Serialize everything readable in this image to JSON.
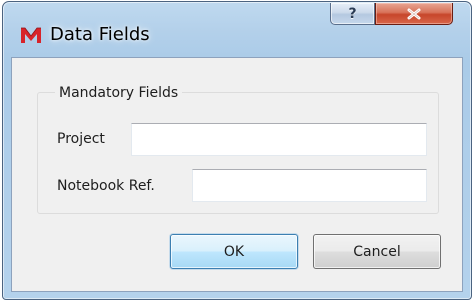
{
  "window": {
    "title": "Data Fields",
    "app_icon": "app-logo-m-icon",
    "controls": {
      "help_label": "?",
      "close_icon": "close-icon"
    }
  },
  "group": {
    "title": "Mandatory Fields",
    "fields": {
      "project": {
        "label": "Project",
        "value": ""
      },
      "notebook_ref": {
        "label": "Notebook Ref.",
        "value": ""
      }
    }
  },
  "buttons": {
    "ok_label": "OK",
    "cancel_label": "Cancel"
  },
  "colors": {
    "title_bar": "#b3d0ea",
    "close_button": "#c7462b",
    "app_icon": "#d8232a",
    "client_background": "#f0f0f0",
    "default_button_border": "#3c7fb1"
  }
}
